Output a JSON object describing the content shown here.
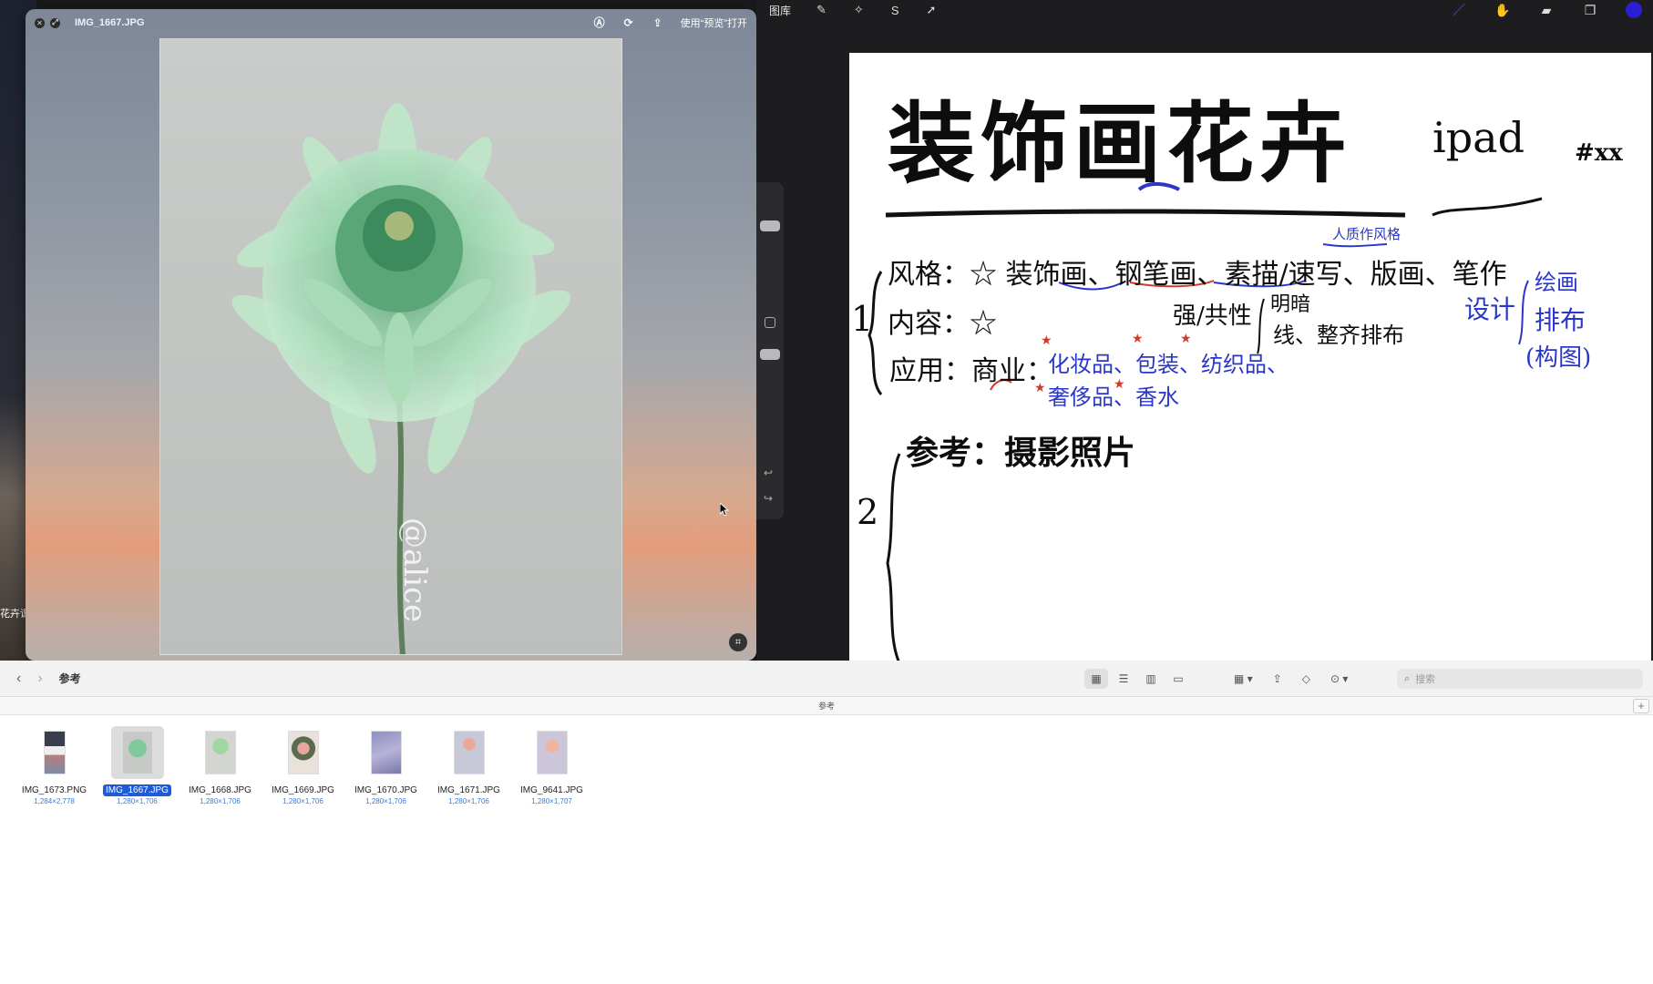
{
  "desktop": {
    "label": "花卉课"
  },
  "preview": {
    "title": "IMG_1667.JPG",
    "open_with": "使用“预览”打开",
    "watermark": "@alice",
    "icons": [
      "close-icon",
      "fullscreen-icon",
      "markup-icon",
      "rotate-icon",
      "share-icon",
      "ocr-icon"
    ]
  },
  "drawapp": {
    "gallery": "图库",
    "tools": [
      "wrench-icon",
      "magic-wand-icon",
      "selection-icon",
      "transform-icon"
    ],
    "right_tools": [
      "brush-icon",
      "smudge-icon",
      "eraser-icon",
      "layers-icon"
    ],
    "color": "#2a1fd2",
    "canvas": {
      "title": "装饰画花卉",
      "title_suffix": "ipad",
      "title_tag": "#xx",
      "note_top": "人质作风格",
      "section1_num": "1",
      "line_style": "风格：☆ 装饰画、钢笔画、素描/速写、版画、笔作",
      "line_content": "内容：☆",
      "line_content_right": "强/共性",
      "line_contrast_a": "明暗",
      "line_contrast_b": "线、整齐排布",
      "line_usage_a": "应用：商业：",
      "line_usage_b": "化妆品、包装、纺织品、",
      "line_usage_c": "奢侈品、香水",
      "side_a": "设计",
      "side_b": "绘画",
      "side_c": "排布",
      "side_d": "(构图)",
      "section2_num": "2",
      "line_ref": "参考：摄影照片"
    }
  },
  "finder": {
    "folder": "参考",
    "path": "参考",
    "search_placeholder": "搜索",
    "files": [
      {
        "name": "IMG_1673.PNG",
        "dims": "1,284×2,778",
        "selected": false
      },
      {
        "name": "IMG_1667.JPG",
        "dims": "1,280×1,706",
        "selected": true
      },
      {
        "name": "IMG_1668.JPG",
        "dims": "1,280×1,706",
        "selected": false
      },
      {
        "name": "IMG_1669.JPG",
        "dims": "1,280×1,706",
        "selected": false
      },
      {
        "name": "IMG_1670.JPG",
        "dims": "1,280×1,706",
        "selected": false
      },
      {
        "name": "IMG_1671.JPG",
        "dims": "1,280×1,706",
        "selected": false
      },
      {
        "name": "IMG_9641.JPG",
        "dims": "1,280×1,707",
        "selected": false
      }
    ]
  }
}
